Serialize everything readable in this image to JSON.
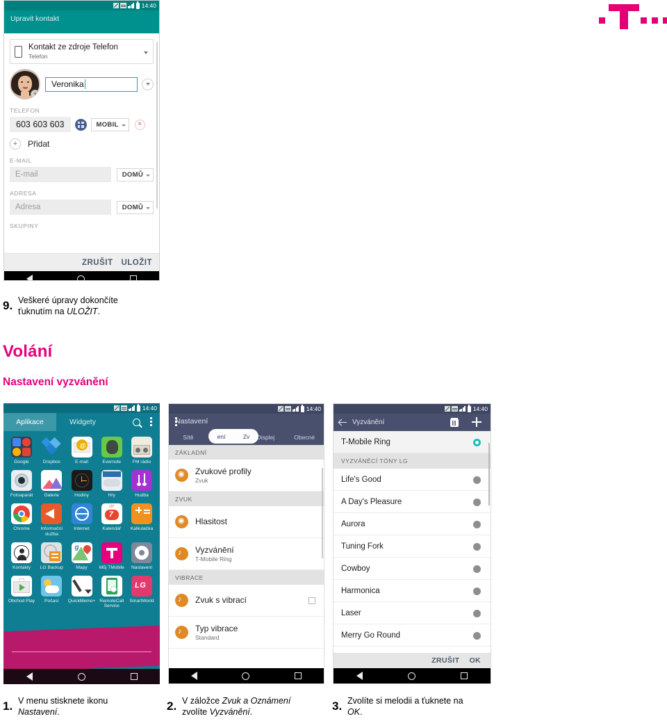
{
  "brand": {
    "logo_name": "t-mobile-logo",
    "magenta": "#e5007d"
  },
  "headings": {
    "section": "Volání",
    "subsection": "Nastavení vyzvánění"
  },
  "steps": {
    "step9": {
      "num": "9.",
      "line1": "Veškeré úpravy dokončíte",
      "line2_pre": "ťuknutím na ",
      "line2_em": "ULOŽIT",
      "line2_post": "."
    },
    "step1": {
      "num": "1.",
      "line1": "V menu stisknete ikonu",
      "line2_em": "Nastavení",
      "line2_post": "."
    },
    "step2": {
      "num": "2.",
      "line1_pre": "V záložce ",
      "line1_em1": "Zvuk a Oznámení",
      "line2_pre": "zvolíte ",
      "line2_em": "Vyzvánění",
      "line2_post": "."
    },
    "step3": {
      "num": "3.",
      "line1": "Zvolíte si melodii a ťuknete na",
      "line2_em": "OK",
      "line2_post": "."
    }
  },
  "statusbar": {
    "time": "14:40",
    "icons": [
      "sim-icon",
      "network-icon",
      "signal-icon",
      "battery-icon"
    ]
  },
  "navbar": {
    "back": "back-icon",
    "home": "home-icon",
    "recents": "recents-icon"
  },
  "phone_contact": {
    "title": "Upravit kontakt",
    "accent": "#00918e",
    "source": {
      "main": "Kontakt ze zdroje Telefon",
      "sub": "Telefon",
      "icon": "phone-icon",
      "caret": "chevron-down-icon"
    },
    "name": {
      "value": "Veronika",
      "avatar": "contact-photo",
      "add_photo": "+",
      "expand": "chevron-down-icon"
    },
    "phone_section": {
      "label": "TELEFON",
      "value": "603 603 603",
      "keypad_icon": "keypad-icon",
      "type": "MOBIL",
      "delete": "×",
      "add": "Přidat",
      "add_icon": "+"
    },
    "email_section": {
      "label": "E-MAIL",
      "placeholder": "E-mail",
      "type": "DOMŮ"
    },
    "address_section": {
      "label": "ADRESA",
      "placeholder": "Adresa",
      "type": "DOMŮ"
    },
    "groups_section": {
      "label": "SKUPINY"
    },
    "footer": {
      "cancel": "ZRUŠIT",
      "save": "ULOŽIT"
    }
  },
  "phone_drawer": {
    "tabs": [
      {
        "label": "Aplikace",
        "active": true
      },
      {
        "label": "Widgety",
        "active": false
      }
    ],
    "search_icon": "search-icon",
    "menu_icon": "more-options-icon",
    "rows": [
      [
        {
          "label": "Google",
          "icon": "google-folder-icon",
          "cls": "ic-google",
          "parts": 4
        },
        {
          "label": "Dropbox",
          "icon": "dropbox-icon",
          "cls": "ic-dropbox",
          "parts": 3
        },
        {
          "label": "E-mail",
          "icon": "email-icon",
          "cls": "ic-mail",
          "parts": 3
        },
        {
          "label": "Evernote",
          "icon": "evernote-icon",
          "cls": "ic-ever",
          "parts": 1
        },
        {
          "label": "FM rádio",
          "icon": "fm-radio-icon",
          "cls": "ic-fm",
          "parts": 3
        }
      ],
      [
        {
          "label": "Fotoaparát",
          "icon": "camera-icon",
          "cls": "ic-cam",
          "parts": 2
        },
        {
          "label": "Galerie",
          "icon": "gallery-icon",
          "cls": "ic-gal",
          "parts": 2
        },
        {
          "label": "Hodiny",
          "icon": "clock-icon",
          "cls": "ic-clock",
          "parts": 3
        },
        {
          "label": "Hry",
          "icon": "games-icon",
          "cls": "ic-game",
          "parts": 2
        },
        {
          "label": "Hudba",
          "icon": "music-icon",
          "cls": "ic-music",
          "parts": 4
        }
      ],
      [
        {
          "label": "Chrome",
          "icon": "chrome-icon",
          "cls": "ic-chrome",
          "parts": 2
        },
        {
          "label": "Informační služba",
          "icon": "info-service-icon",
          "cls": "ic-info",
          "parts": 1
        },
        {
          "label": "Internet",
          "icon": "internet-icon",
          "cls": "ic-inet",
          "parts": 1
        },
        {
          "label": "Kalendář",
          "icon": "calendar-icon",
          "cls": "ic-cal",
          "parts": 3,
          "cal_top": "ÚT",
          "cal_day": "7"
        },
        {
          "label": "Kalkulačka",
          "icon": "calculator-icon",
          "cls": "ic-calc",
          "parts": 3
        }
      ],
      [
        {
          "label": "Kontakty",
          "icon": "contacts-icon",
          "cls": "ic-cont",
          "parts": 3
        },
        {
          "label": "LG Backup",
          "icon": "lg-backup-icon",
          "cls": "ic-bk",
          "parts": 3
        },
        {
          "label": "Mapy",
          "icon": "maps-icon",
          "cls": "ic-maps",
          "parts": 3,
          "maps_g": "g"
        },
        {
          "label": "Můj TMobile",
          "icon": "my-tmobile-icon",
          "cls": "ic-tmo",
          "parts": 2
        },
        {
          "label": "Nastavení",
          "icon": "settings-gear-icon",
          "cls": "ic-set",
          "parts": 2
        }
      ],
      [
        {
          "label": "Obchod Play",
          "icon": "play-store-icon",
          "cls": "ic-play",
          "parts": 3
        },
        {
          "label": "Počasí",
          "icon": "weather-icon",
          "cls": "ic-weather",
          "parts": 2
        },
        {
          "label": "QuickMemo+",
          "icon": "quickmemo-icon",
          "cls": "ic-qm",
          "parts": 2
        },
        {
          "label": "RemoteCall Service",
          "icon": "remotecall-icon",
          "cls": "ic-rc",
          "parts": 3
        },
        {
          "label": "SmartWorld",
          "icon": "smartworld-icon",
          "cls": "ic-lg",
          "parts": 1,
          "lg_text": "LG"
        }
      ]
    ]
  },
  "phone_settings": {
    "title": "Nastavení",
    "menu_icon": "more-options-icon",
    "tabs": [
      "Sítě",
      "Zvuk a Oznámení",
      "Displej",
      "Obecné"
    ],
    "highlight_pill": {
      "left_text": "ení",
      "right_text": "Zv",
      "shape": "rounded-highlight"
    },
    "groups": [
      {
        "header": "ZÁKLADNÍ",
        "items": [
          {
            "title": "Zvukové profily",
            "sub": "Zvuk",
            "icon": "sound-profile-icon",
            "glyph": "◉",
            "checkbox": false
          }
        ]
      },
      {
        "header": "ZVUK",
        "items": [
          {
            "title": "Hlasitost",
            "sub": "",
            "icon": "volume-icon",
            "glyph": "◉",
            "checkbox": false
          },
          {
            "title": "Vyzvánění",
            "sub": "T-Mobile Ring",
            "icon": "ringtone-icon",
            "glyph": "♪",
            "checkbox": false
          }
        ]
      },
      {
        "header": "VIBRACE",
        "items": [
          {
            "title": "Zvuk s vibrací",
            "sub": "",
            "icon": "vibrate-sound-icon",
            "glyph": "♪",
            "checkbox": true
          },
          {
            "title": "Typ vibrace",
            "sub": "Standard",
            "icon": "vibrate-type-icon",
            "glyph": "♪",
            "checkbox": false
          }
        ]
      }
    ]
  },
  "phone_ringtone": {
    "title": "Vyzvánění",
    "back_icon": "arrow-back-icon",
    "delete_icon": "trash-icon",
    "add_icon": "plus-icon",
    "selected": "T-Mobile Ring",
    "items_top": [
      {
        "label": "T-Mobile Ring",
        "selected": true
      }
    ],
    "group_header": "VYZVÁNĚCÍ TÓNY LG",
    "items": [
      {
        "label": "Life's Good",
        "selected": false
      },
      {
        "label": "A Day's Pleasure",
        "selected": false
      },
      {
        "label": "Aurora",
        "selected": false
      },
      {
        "label": "Tuning Fork",
        "selected": false
      },
      {
        "label": "Cowboy",
        "selected": false
      },
      {
        "label": "Harmonica",
        "selected": false
      },
      {
        "label": "Laser",
        "selected": false
      },
      {
        "label": "Merry Go Round",
        "selected": false
      }
    ],
    "footer": {
      "cancel": "ZRUŠIT",
      "ok": "OK"
    }
  }
}
